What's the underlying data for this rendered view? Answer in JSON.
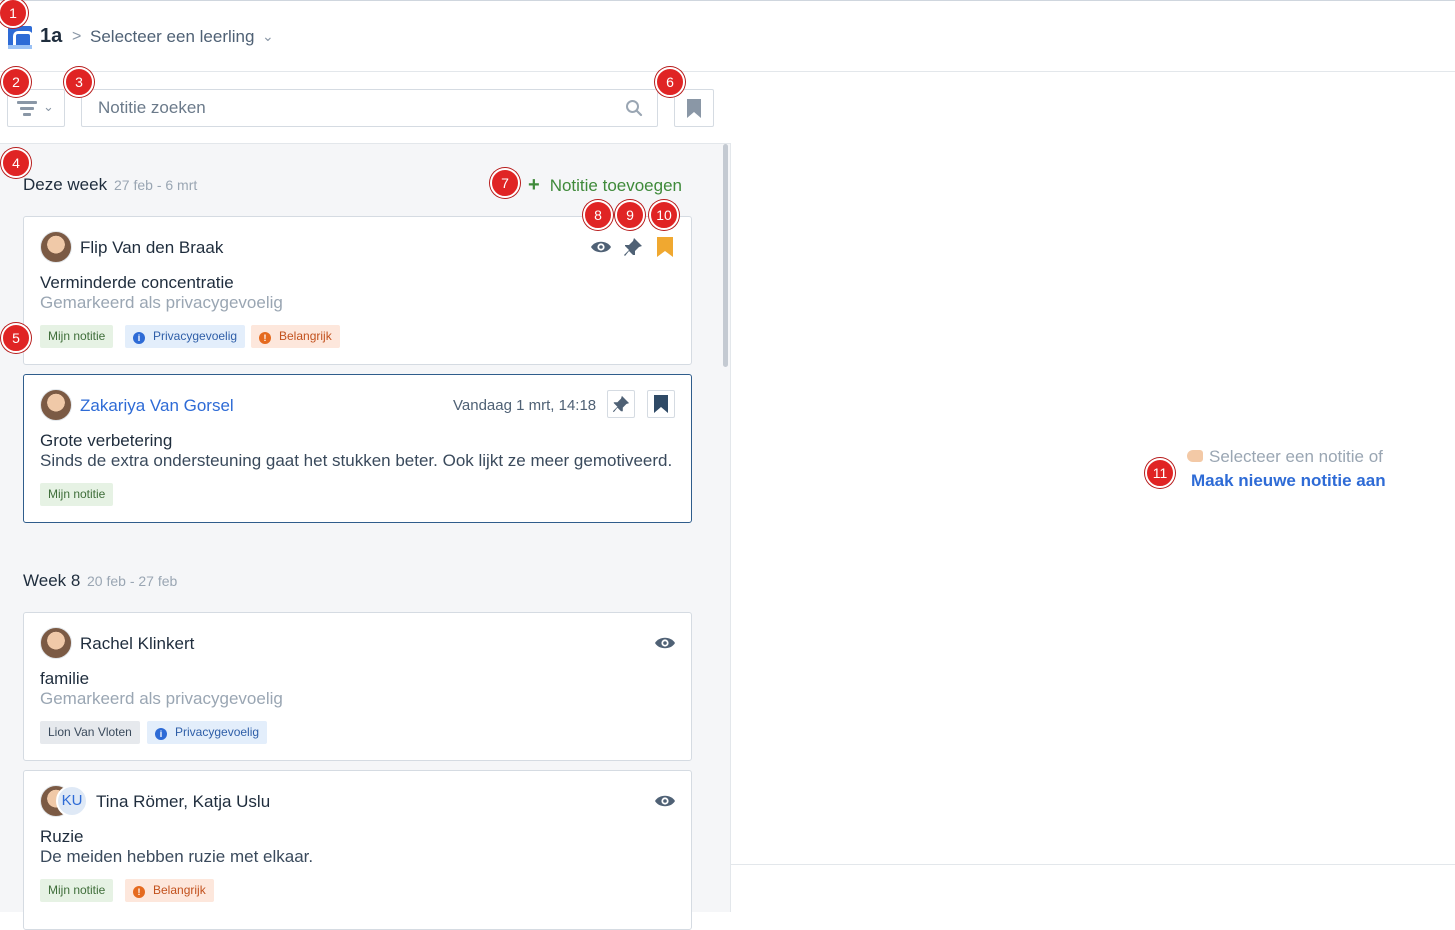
{
  "header": {
    "class_label": "1a",
    "separator": ">",
    "student_select": "Selecteer een leerling",
    "chevron": "⌄"
  },
  "toolbar": {
    "search_placeholder": "Notitie zoeken"
  },
  "weeks": [
    {
      "title": "Deze week",
      "range": "27 feb - 6 mrt",
      "add_label": "Notitie toevoegen"
    },
    {
      "title": "Week 8",
      "range": "20 feb - 27 feb"
    }
  ],
  "cards": [
    {
      "name": "Flip Van den Braak",
      "title": "Verminderde concentratie",
      "subtitle": "Gemarkeerd als privacygevoelig",
      "tags": [
        "Mijn notitie",
        "Privacygevoelig",
        "Belangrijk"
      ]
    },
    {
      "name": "Zakariya Van Gorsel",
      "timestamp": "Vandaag 1 mrt, 14:18",
      "title": "Grote verbetering",
      "text": "Sinds de extra ondersteuning gaat het stukken beter. Ook lijkt ze meer gemotiveerd.",
      "tags": [
        "Mijn notitie"
      ]
    },
    {
      "name": "Rachel Klinkert",
      "title": "familie",
      "subtitle": "Gemarkeerd als privacygevoelig",
      "tags": [
        "Lion Van Vloten",
        "Privacygevoelig"
      ]
    },
    {
      "name": "Tina Römer, Katja Uslu",
      "initials": "KU",
      "title": "Ruzie",
      "text": "De meiden hebben ruzie met elkaar.",
      "tags": [
        "Mijn notitie",
        "Belangrijk"
      ]
    }
  ],
  "empty_state": {
    "prompt": "Selecteer een notitie of",
    "link": "Maak nieuwe notitie aan"
  },
  "markers": [
    "1",
    "2",
    "3",
    "4",
    "5",
    "6",
    "7",
    "8",
    "9",
    "10",
    "11"
  ],
  "colors": {
    "accent": "#2e6bd6",
    "add_green": "#3f8a3a",
    "bookmark_active": "#f0a830",
    "marker_red": "#e02424"
  },
  "icons": [
    "logo-icon",
    "filter-icon",
    "search-icon",
    "bookmark-icon",
    "eye-icon",
    "pin-icon",
    "plus-icon",
    "info-icon",
    "alert-icon",
    "hand-pointer-icon"
  ]
}
